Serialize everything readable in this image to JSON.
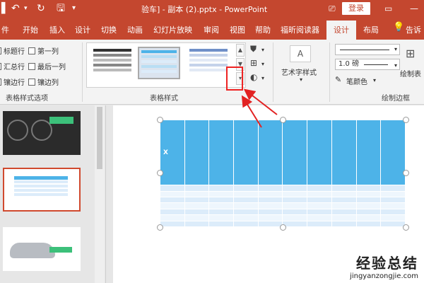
{
  "titlebar": {
    "doc_title": "验车] - 副本 (2).pptx - PowerPoint",
    "login_label": "登录",
    "undo_glyph": "↶",
    "redo_glyph": "↻",
    "save_glyph": "🖫",
    "window_ctrl_glyph": "⎚",
    "minimize_glyph": "—",
    "restore_glyph": "▭"
  },
  "tabs": [
    {
      "label": "件"
    },
    {
      "label": "开始"
    },
    {
      "label": "插入"
    },
    {
      "label": "设计"
    },
    {
      "label": "切换"
    },
    {
      "label": "动画"
    },
    {
      "label": "幻灯片放映"
    },
    {
      "label": "审阅"
    },
    {
      "label": "视图"
    },
    {
      "label": "帮助"
    },
    {
      "label": "福昕阅读器"
    },
    {
      "label": "设计"
    },
    {
      "label": "布局"
    },
    {
      "label": "告诉"
    }
  ],
  "ribbon": {
    "options": [
      {
        "label": "标题行"
      },
      {
        "label": "第一列"
      },
      {
        "label": "汇总行"
      },
      {
        "label": "最后一列"
      },
      {
        "label": "镶边行"
      },
      {
        "label": "镶边列"
      }
    ],
    "group_options_label": "表格样式选项",
    "group_styles_label": "表格样式",
    "wordart_label": "艺术字样式",
    "pen_weight": "1.0 磅",
    "pen_color_label": "笔颜色",
    "draw_table_label": "绘制表",
    "group_borders_label": "绘制边框"
  },
  "table": {
    "header_mark": "X"
  },
  "watermark": {
    "big": "经验总结",
    "small": "jingyanzongjie.com"
  },
  "colors": {
    "accent": "#c4472f",
    "table_header": "#4db3e8",
    "table_band": "#dcecfa",
    "arrow": "#e22222"
  }
}
